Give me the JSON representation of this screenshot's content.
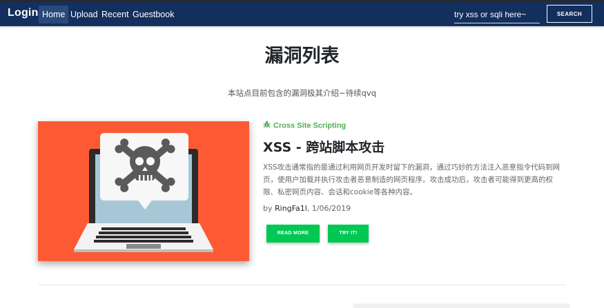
{
  "navbar": {
    "brand": "Login",
    "items": [
      {
        "label": "Home",
        "active": true
      },
      {
        "label": "Upload",
        "active": false
      },
      {
        "label": "Recent",
        "active": false
      },
      {
        "label": "Guestbook",
        "active": false
      }
    ],
    "search": {
      "placeholder": "try xss or sqli here~",
      "button_label": "SEARCH"
    }
  },
  "header": {
    "title": "漏洞列表",
    "subtitle": "本站点目前包含的漏洞极其介绍~待续qvq"
  },
  "post": {
    "category": "Cross Site Scripting",
    "category_icon": "bug-icon",
    "image_icon": "laptop-skull-illustration",
    "title": "XSS - 跨站脚本攻击",
    "description": "XSS攻击通常指的是通过利用网页开发时留下的漏洞，通过巧妙的方法注入恶意指令代码到网页，使用户加载并执行攻击者恶意制造的网页程序。攻击成功后，攻击者可能得到更高的权限、私密网页内容、会话和cookie等各种内容。",
    "byline_prefix": "by ",
    "author": "RingFa1l",
    "date": ", 1/06/2019",
    "read_more_label": "READ MORE",
    "try_label": "TRY IT!"
  },
  "colors": {
    "navbar": "#132f5d",
    "accent_green": "#00c853",
    "category_green": "#4caf50",
    "image_bg": "#fd5a34"
  }
}
